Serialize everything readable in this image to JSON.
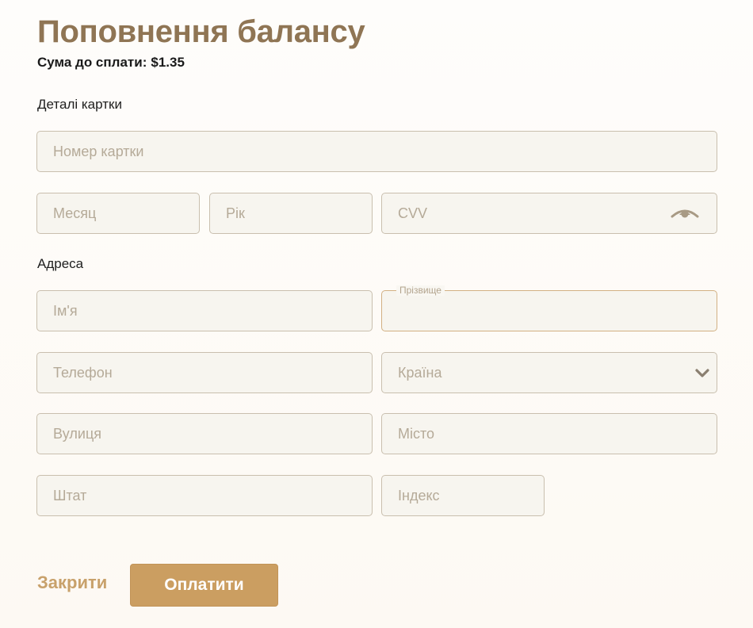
{
  "header": {
    "title": "Поповнення балансу",
    "amount_label": "Сума до сплати:",
    "amount_value": "$1.35"
  },
  "card_section": {
    "label": "Деталі картки",
    "card_number_placeholder": "Номер картки",
    "month_placeholder": "Месяц",
    "year_placeholder": "Рік",
    "cvv_placeholder": "CVV",
    "cvv_visibility_icon": "eye-icon"
  },
  "address_section": {
    "label": "Адреса",
    "first_name_placeholder": "Ім'я",
    "last_name_label": "Прізвище",
    "phone_placeholder": "Телефон",
    "country_selected": "Країна",
    "country_icon": "chevron-down-icon",
    "street_placeholder": "Вулиця",
    "city_placeholder": "Місто",
    "state_placeholder": "Штат",
    "zip_placeholder": "Індекс"
  },
  "actions": {
    "close_label": "Закрити",
    "pay_label": "Оплатити"
  },
  "colors": {
    "title": "#8f7554",
    "accent": "#cb9e61",
    "field_background": "#f7f5ef",
    "field_border": "#c9bfae",
    "focused_border": "#d2b083"
  }
}
